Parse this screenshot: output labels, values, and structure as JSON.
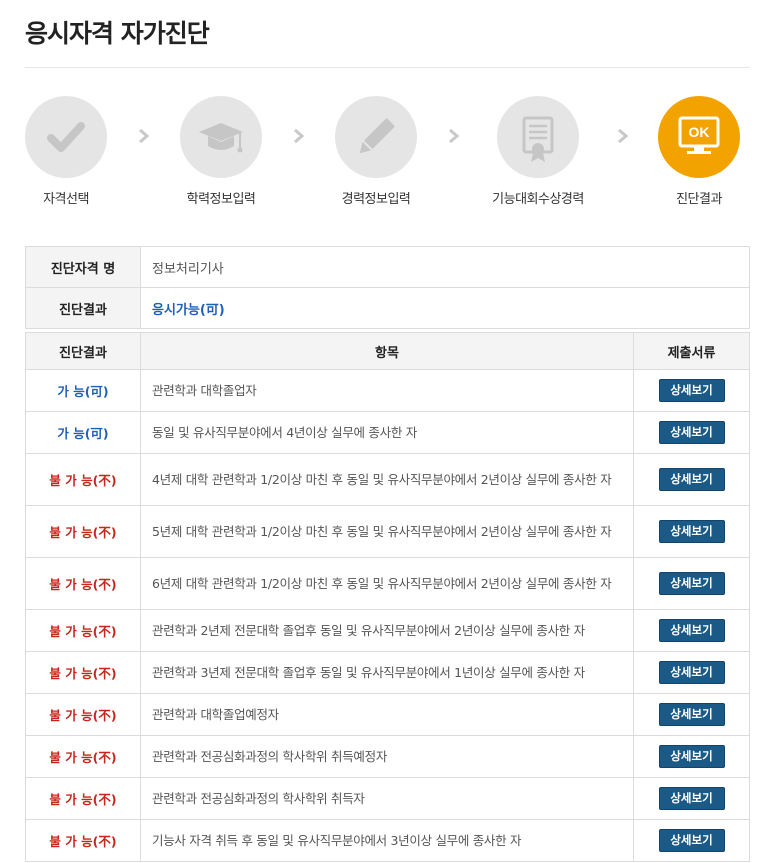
{
  "page": {
    "title": "응시자격 자가진단"
  },
  "steps": [
    {
      "label": "자격선택",
      "icon": "check-icon"
    },
    {
      "label": "학력정보입력",
      "icon": "graduation-cap-icon"
    },
    {
      "label": "경력정보입력",
      "icon": "pencil-icon"
    },
    {
      "label": "기능대회수상경력",
      "icon": "certificate-icon"
    },
    {
      "label": "진단결과",
      "icon": "monitor-ok-icon",
      "icon_text": "OK",
      "active": true
    }
  ],
  "info": {
    "qualification_label": "진단자격 명",
    "qualification_value": "정보처리기사",
    "result_label": "진단결과",
    "result_value": "응시가능(可)"
  },
  "table": {
    "headers": [
      "진단결과",
      "항목",
      "제출서류"
    ],
    "button_label": "상세보기",
    "rows": [
      {
        "result": "가 능(可)",
        "status": "ok",
        "item": "관련학과 대학졸업자"
      },
      {
        "result": "가 능(可)",
        "status": "ok",
        "item": "동일 및 유사직무분야에서 4년이상 실무에 종사한 자"
      },
      {
        "result": "불 가 능(不)",
        "status": "no",
        "item": "4년제 대학 관련학과 1/2이상 마친 후 동일 및 유사직무분야에서 2년이상 실무에 종사한 자"
      },
      {
        "result": "불 가 능(不)",
        "status": "no",
        "item": "5년제 대학 관련학과 1/2이상 마친 후 동일 및 유사직무분야에서 2년이상 실무에 종사한 자"
      },
      {
        "result": "불 가 능(不)",
        "status": "no",
        "item": "6년제 대학 관련학과 1/2이상 마친 후 동일 및 유사직무분야에서 2년이상 실무에 종사한 자"
      },
      {
        "result": "불 가 능(不)",
        "status": "no",
        "item": "관련학과 2년제 전문대학 졸업후 동일 및 유사직무분야에서 2년이상 실무에 종사한 자"
      },
      {
        "result": "불 가 능(不)",
        "status": "no",
        "item": "관련학과 3년제 전문대학 졸업후 동일 및 유사직무분야에서 1년이상 실무에 종사한 자"
      },
      {
        "result": "불 가 능(不)",
        "status": "no",
        "item": "관련학과 대학졸업예정자"
      },
      {
        "result": "불 가 능(不)",
        "status": "no",
        "item": "관련학과 전공심화과정의 학사학위 취득예정자"
      },
      {
        "result": "불 가 능(不)",
        "status": "no",
        "item": "관련학과 전공심화과정의 학사학위 취득자"
      },
      {
        "result": "불 가 능(不)",
        "status": "no",
        "item": "기능사 자격 취득 후 동일 및 유사직무분야에서 3년이상 실무에 종사한 자"
      }
    ]
  },
  "colors": {
    "active_step": "#f3a300",
    "inactive_step": "#e5e5e5",
    "ok_text": "#1e5fb8",
    "no_text": "#c8261a",
    "button_bg": "#1b5a86"
  }
}
